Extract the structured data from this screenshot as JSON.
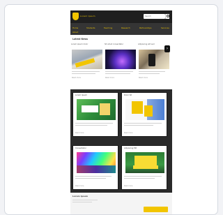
{
  "header": {
    "site_name": "Lorem Ipsum",
    "search_placeholder": "Search"
  },
  "nav": {
    "items": [
      "Home",
      "Students",
      "Teaching",
      "Research",
      "Partnerships",
      "Services",
      "About"
    ]
  },
  "news": {
    "heading": "Latest News",
    "cards": [
      {
        "title": "Lorem ipsum dolor",
        "more": "Read more"
      },
      {
        "title": "Sit amet consectetur",
        "more": "Read more"
      },
      {
        "title": "Adipiscing elit sed",
        "more": "Read more"
      }
    ]
  },
  "tiles": [
    {
      "title": "Lorem Ipsum",
      "link": "Read more"
    },
    {
      "title": "Dolor Sit",
      "link": "Read more"
    },
    {
      "title": "Consectetur",
      "link": "Read more"
    },
    {
      "title": "Adipiscing Elit",
      "link": "Read more"
    }
  ],
  "bottom": {
    "title": "Lorem Ipsum"
  },
  "colors": {
    "brand_yellow": "#f2c500",
    "header_dark": "#1f1f1f",
    "nav_dark": "#353535"
  },
  "icons": {
    "search": "search-icon",
    "next": "chevron-right-icon"
  }
}
